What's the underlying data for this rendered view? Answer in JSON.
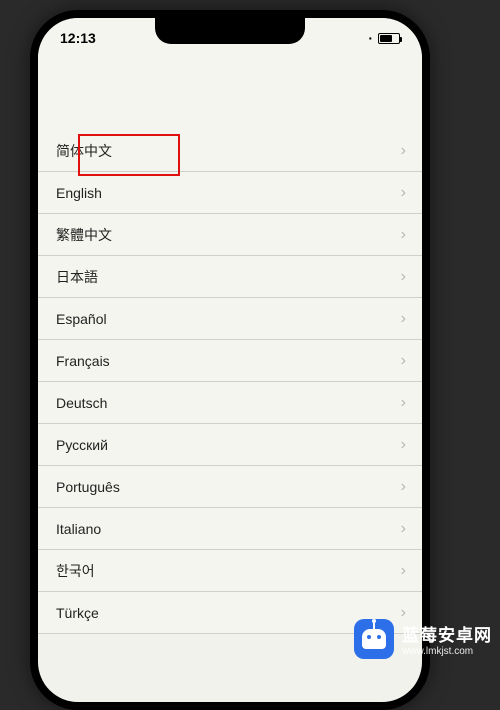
{
  "status_bar": {
    "time": "12:13"
  },
  "languages": [
    {
      "label": "简体中文"
    },
    {
      "label": "English"
    },
    {
      "label": "繁體中文"
    },
    {
      "label": "日本語"
    },
    {
      "label": "Español"
    },
    {
      "label": "Français"
    },
    {
      "label": "Deutsch"
    },
    {
      "label": "Русский"
    },
    {
      "label": "Português"
    },
    {
      "label": "Italiano"
    },
    {
      "label": "한국어"
    },
    {
      "label": "Türkçe"
    }
  ],
  "watermark": {
    "title": "蓝莓安卓网",
    "url": "www.lmkjst.com"
  }
}
